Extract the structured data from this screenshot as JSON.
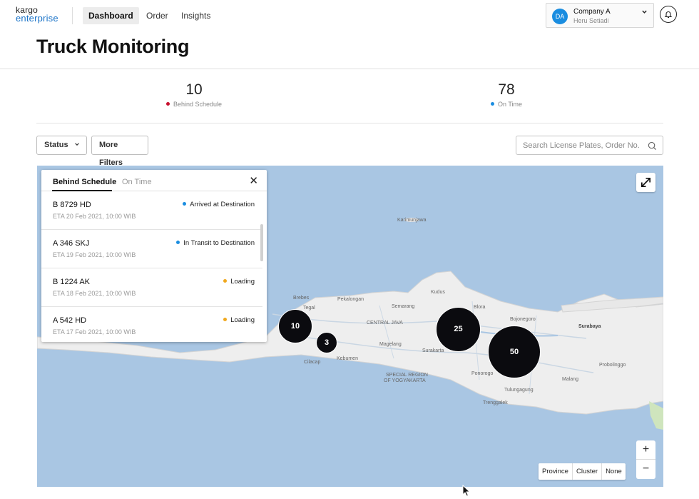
{
  "nav": {
    "logo_line1": "kargo",
    "logo_line2": "enterprise",
    "items": [
      {
        "label": "Dashboard",
        "active": true
      },
      {
        "label": "Order",
        "active": false
      },
      {
        "label": "Insights",
        "active": false
      }
    ],
    "company": {
      "avatar": "DA",
      "name": "Company A",
      "user": "Heru Setiadi"
    },
    "bell_icon": "bell-icon"
  },
  "page_title": "Truck Monitoring",
  "stats": [
    {
      "value": "10",
      "label": "Behind Schedule",
      "color": "#c8102e"
    },
    {
      "value": "78",
      "label": "On Time",
      "color": "#1a8de0"
    }
  ],
  "filters": {
    "status_label": "Status",
    "more_label": "More Filters",
    "search_placeholder": "Search License Plates, Order No."
  },
  "panel": {
    "tabs": [
      "Behind Schedule",
      "On Time"
    ],
    "rows": [
      {
        "plate": "B 8729 HD",
        "eta": "ETA 20 Feb 2021, 10:00 WIB",
        "status": "Arrived at Destination",
        "color": "#1a8de0"
      },
      {
        "plate": "A 346 SKJ",
        "eta": "ETA 19 Feb 2021, 10:00 WIB",
        "status": "In Transit to Destination",
        "color": "#1a8de0"
      },
      {
        "plate": "B 1224 AK",
        "eta": "ETA 18 Feb 2021, 10:00 WIB",
        "status": "Loading",
        "color": "#f0a81e"
      },
      {
        "plate": "A 542 HD",
        "eta": "ETA 17 Feb 2021, 10:00 WIB",
        "status": "Loading",
        "color": "#f0a81e"
      }
    ]
  },
  "map": {
    "clusters": [
      "10",
      "3",
      "25",
      "50"
    ],
    "labels": {
      "karimunjawa": "Karimunjawa",
      "kudus": "Kudus",
      "brebes": "Brebes",
      "pekalongan": "Pekalongan",
      "semarang": "Semarang",
      "tegal": "Tegal",
      "blora": "Blora",
      "bojonegoro": "Bojonegoro",
      "surabaya": "Surabaya",
      "central_java": "CENTRAL JAVA",
      "magelang": "Magelang",
      "surakarta": "Surakarta",
      "special_region": "SPECIAL REGION",
      "of_yogyakarta": "OF YOGYAKARTA",
      "cilacap": "Cilacap",
      "kebumen": "Kebumen",
      "ponorogo": "Ponorogo",
      "tulungagung": "Tulungagung",
      "malang": "Malang",
      "probolinggo": "Probolinggo",
      "trenggalek": "Trenggalek"
    },
    "view_modes": [
      "Province",
      "Cluster",
      "None"
    ]
  }
}
